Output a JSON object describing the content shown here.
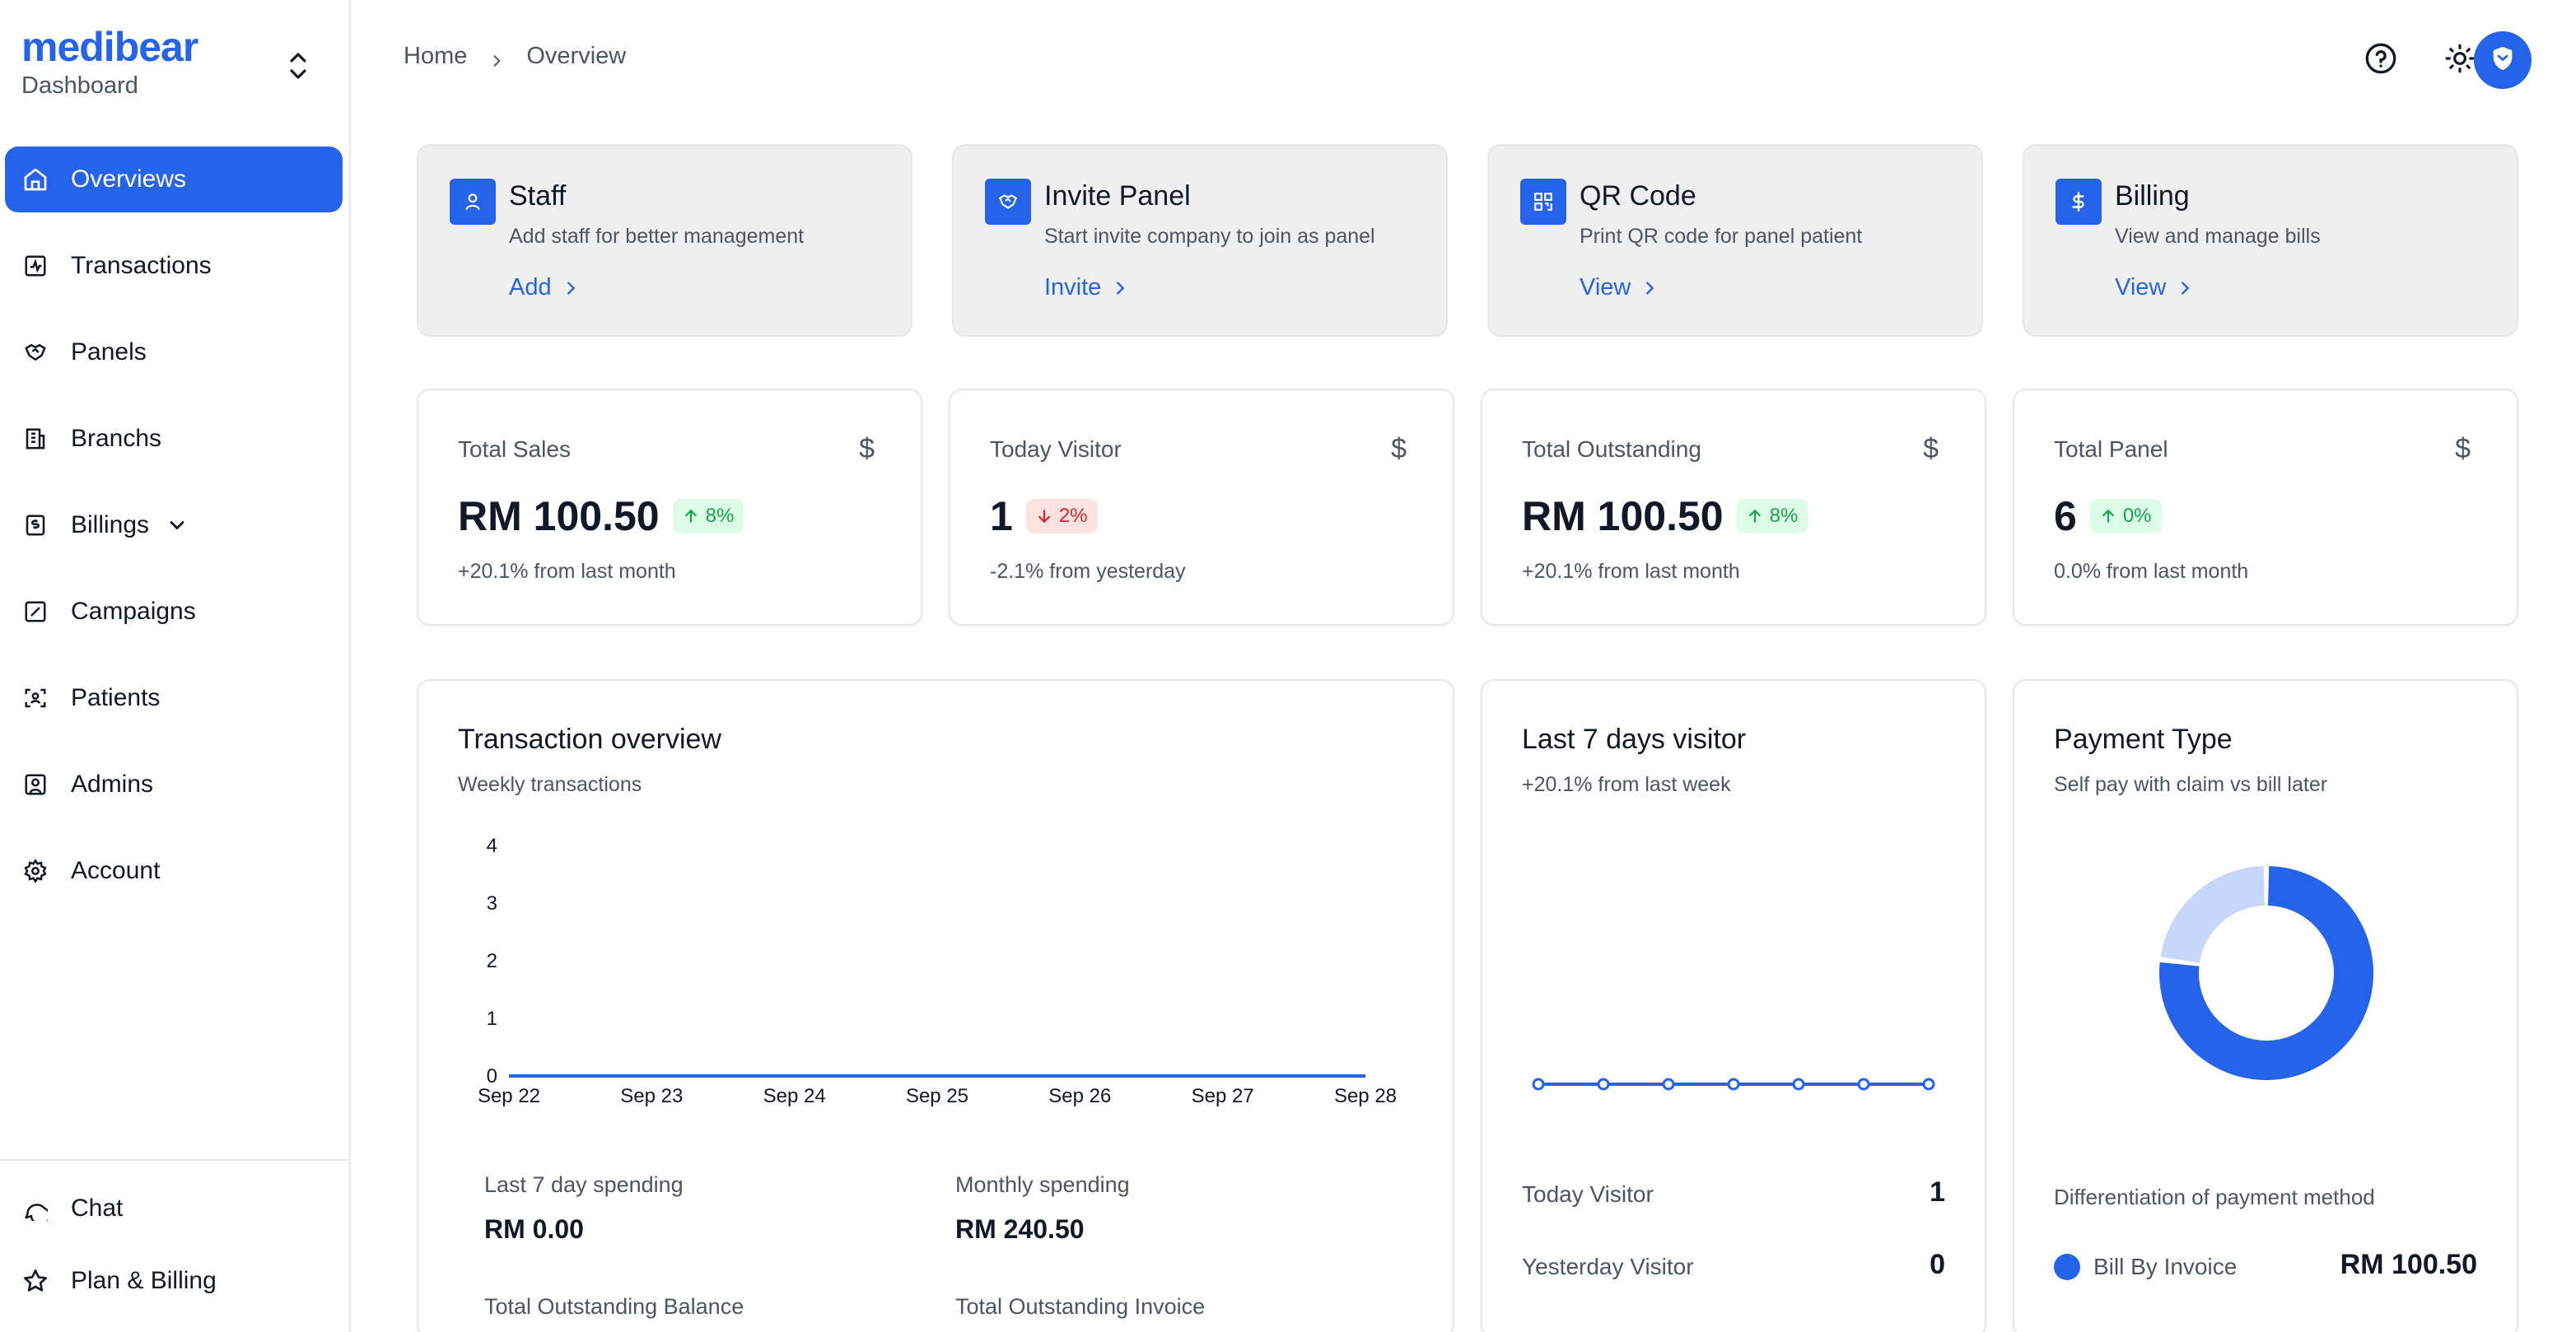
{
  "brand": {
    "logo": "medibear",
    "subtitle": "Dashboard"
  },
  "sidebar": {
    "items": [
      {
        "label": "Overviews",
        "icon": "home-icon",
        "active": true
      },
      {
        "label": "Transactions",
        "icon": "activity-icon"
      },
      {
        "label": "Panels",
        "icon": "handshake-icon"
      },
      {
        "label": "Branchs",
        "icon": "building-icon"
      },
      {
        "label": "Billings",
        "icon": "receipt-icon",
        "expandable": true
      },
      {
        "label": "Campaigns",
        "icon": "campaign-icon"
      },
      {
        "label": "Patients",
        "icon": "scan-user-icon"
      },
      {
        "label": "Admins",
        "icon": "user-square-icon"
      },
      {
        "label": "Account",
        "icon": "gear-icon"
      }
    ],
    "bottom": [
      {
        "label": "Chat",
        "icon": "chat-icon"
      },
      {
        "label": "Plan & Billing",
        "icon": "star-icon"
      }
    ]
  },
  "breadcrumb": {
    "home": "Home",
    "current": "Overview"
  },
  "quick_actions": [
    {
      "title": "Staff",
      "desc": "Add staff for better management",
      "action": "Add",
      "icon": "user-icon"
    },
    {
      "title": "Invite Panel",
      "desc": "Start invite company to join as panel",
      "action": "Invite",
      "icon": "handshake-icon"
    },
    {
      "title": "QR Code",
      "desc": "Print QR code for panel patient",
      "action": "View",
      "icon": "qr-code-icon"
    },
    {
      "title": "Billing",
      "desc": "View and manage bills",
      "action": "View",
      "icon": "dollar-icon"
    }
  ],
  "stats": [
    {
      "label": "Total Sales",
      "value": "RM 100.50",
      "badge": "8%",
      "trend": "up",
      "sub": "+20.1% from last month"
    },
    {
      "label": "Today Visitor",
      "value": "1",
      "badge": "2%",
      "trend": "down",
      "sub": "-2.1% from yesterday"
    },
    {
      "label": "Total Outstanding",
      "value": "RM 100.50",
      "badge": "8%",
      "trend": "up",
      "sub": "+20.1% from last month"
    },
    {
      "label": "Total Panel",
      "value": "6",
      "badge": "0%",
      "trend": "up",
      "sub": "0.0% from last month"
    }
  ],
  "currency_symbol": "$",
  "transaction_overview": {
    "title": "Transaction overview",
    "subtitle": "Weekly transactions",
    "last7_label": "Last 7 day spending",
    "last7_value": "RM 0.00",
    "monthly_label": "Monthly spending",
    "monthly_value": "RM 240.50",
    "outstanding_balance_label": "Total Outstanding Balance",
    "outstanding_invoice_label": "Total Outstanding Invoice"
  },
  "visitor_card": {
    "title": "Last 7 days visitor",
    "subtitle": "+20.1% from last week",
    "today_label": "Today Visitor",
    "today_value": "1",
    "yesterday_label": "Yesterday Visitor",
    "yesterday_value": "0"
  },
  "payment_card": {
    "title": "Payment Type",
    "subtitle": "Self pay with claim vs bill later",
    "diff_label": "Differentiation of payment method",
    "bill_invoice_label": "Bill By Invoice",
    "bill_invoice_value": "RM 100.50"
  },
  "colors": {
    "accent": "#2563eb",
    "accent_light": "#c7d7fb",
    "up": "#16a34a",
    "down": "#dc2626"
  },
  "chart_data": [
    {
      "type": "line",
      "title": "Transaction overview",
      "categories": [
        "Sep 22",
        "Sep 23",
        "Sep 24",
        "Sep 25",
        "Sep 26",
        "Sep 27",
        "Sep 28"
      ],
      "values": [
        0,
        0,
        0,
        0,
        0,
        0,
        0
      ],
      "y_ticks": [
        0,
        1,
        2,
        3,
        4
      ],
      "ylim": [
        0,
        4
      ]
    },
    {
      "type": "line",
      "title": "Last 7 days visitor",
      "values": [
        0,
        0,
        0,
        0,
        0,
        0,
        0
      ]
    },
    {
      "type": "pie",
      "title": "Payment Type",
      "values": [
        100.5,
        30
      ],
      "colors": [
        "#2563eb",
        "#c7d7fb"
      ]
    }
  ]
}
